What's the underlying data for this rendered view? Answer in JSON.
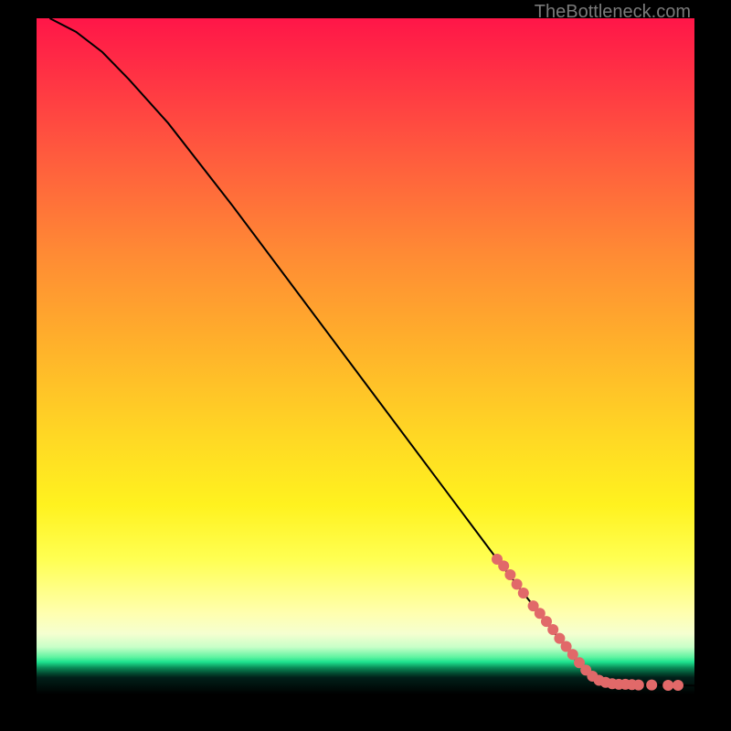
{
  "watermark": "TheBottleneck.com",
  "chart_data": {
    "type": "line",
    "title": "",
    "xlabel": "",
    "ylabel": "",
    "xlim": [
      0,
      100
    ],
    "ylim": [
      0,
      100
    ],
    "curve": [
      {
        "x": 2,
        "y": 100
      },
      {
        "x": 6,
        "y": 98
      },
      {
        "x": 10,
        "y": 95
      },
      {
        "x": 14,
        "y": 91
      },
      {
        "x": 20,
        "y": 84.5
      },
      {
        "x": 30,
        "y": 72
      },
      {
        "x": 40,
        "y": 59
      },
      {
        "x": 50,
        "y": 46
      },
      {
        "x": 60,
        "y": 33
      },
      {
        "x": 70,
        "y": 20
      },
      {
        "x": 78,
        "y": 10
      },
      {
        "x": 82,
        "y": 5
      },
      {
        "x": 85,
        "y": 2.5
      },
      {
        "x": 88,
        "y": 1.5
      },
      {
        "x": 92,
        "y": 1.4
      },
      {
        "x": 96,
        "y": 1.4
      },
      {
        "x": 100,
        "y": 1.3
      }
    ],
    "markers": [
      {
        "x": 70,
        "y": 20,
        "r": 6
      },
      {
        "x": 71,
        "y": 19,
        "r": 6
      },
      {
        "x": 72,
        "y": 17.7,
        "r": 6
      },
      {
        "x": 73,
        "y": 16.3,
        "r": 6
      },
      {
        "x": 74,
        "y": 15,
        "r": 6
      },
      {
        "x": 75.5,
        "y": 13.1,
        "r": 6
      },
      {
        "x": 76.5,
        "y": 12,
        "r": 6
      },
      {
        "x": 77.5,
        "y": 10.8,
        "r": 6
      },
      {
        "x": 78.5,
        "y": 9.6,
        "r": 6
      },
      {
        "x": 79.5,
        "y": 8.3,
        "r": 6
      },
      {
        "x": 80.5,
        "y": 7.1,
        "r": 6
      },
      {
        "x": 81.5,
        "y": 5.9,
        "r": 6
      },
      {
        "x": 82.5,
        "y": 4.7,
        "r": 6
      },
      {
        "x": 83.5,
        "y": 3.6,
        "r": 6
      },
      {
        "x": 84.5,
        "y": 2.7,
        "r": 6
      },
      {
        "x": 85.5,
        "y": 2.1,
        "r": 6
      },
      {
        "x": 86.5,
        "y": 1.8,
        "r": 6
      },
      {
        "x": 87.5,
        "y": 1.6,
        "r": 6
      },
      {
        "x": 88.5,
        "y": 1.5,
        "r": 6
      },
      {
        "x": 89.5,
        "y": 1.5,
        "r": 6
      },
      {
        "x": 90.5,
        "y": 1.45,
        "r": 6
      },
      {
        "x": 91.5,
        "y": 1.4,
        "r": 6
      },
      {
        "x": 93.5,
        "y": 1.4,
        "r": 6
      },
      {
        "x": 96,
        "y": 1.35,
        "r": 6
      },
      {
        "x": 97.5,
        "y": 1.35,
        "r": 6
      }
    ],
    "gradient_legend": null
  }
}
